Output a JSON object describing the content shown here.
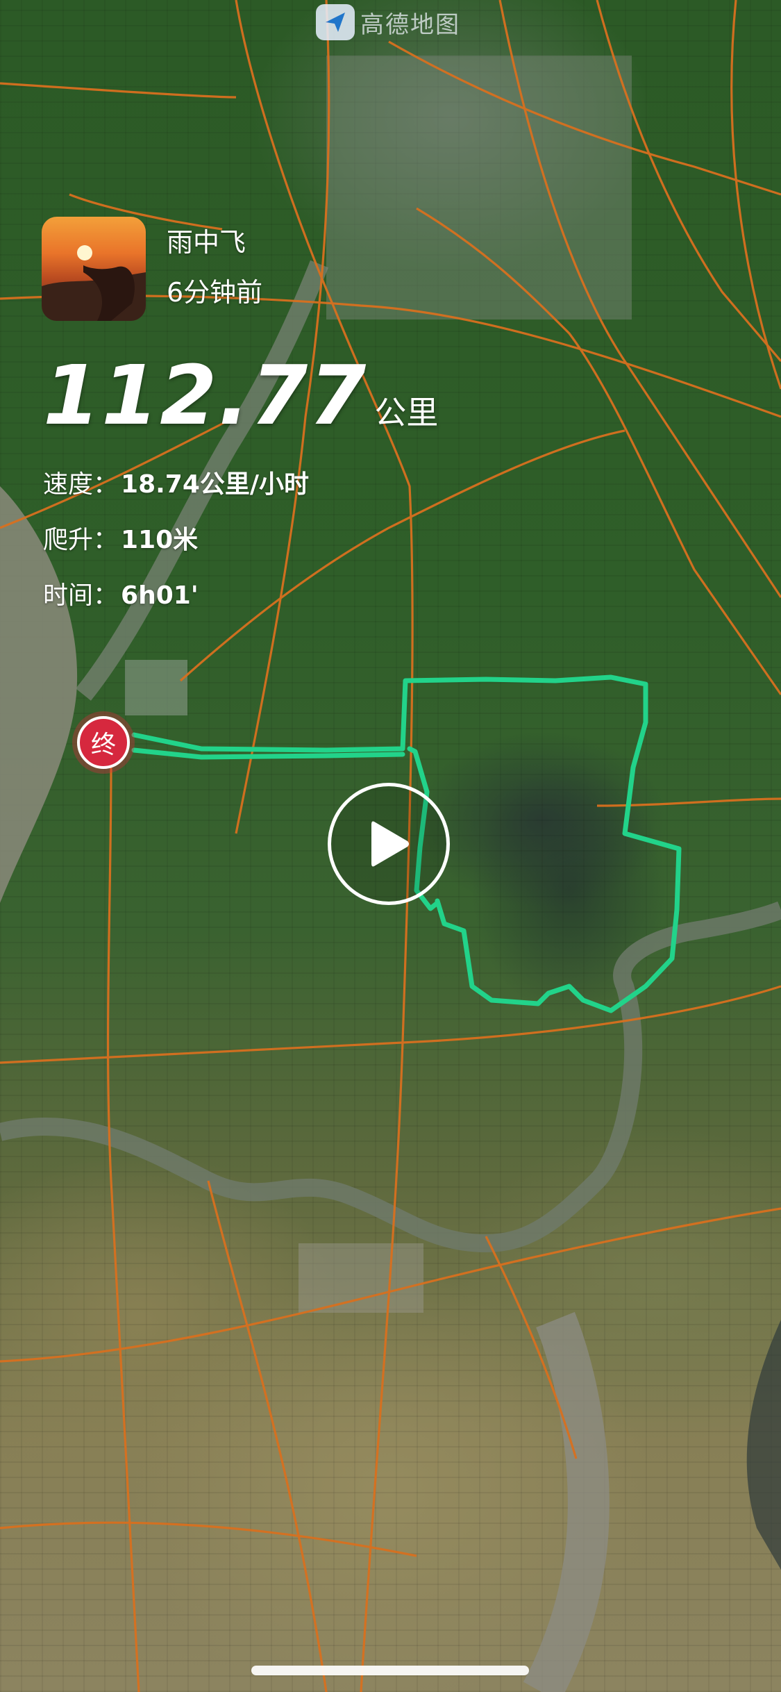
{
  "watermark": {
    "text": "高德地图",
    "icon": "amap-logo-icon"
  },
  "user": {
    "name": "雨中飞",
    "time_ago": "6分钟前",
    "avatar": "sunset-hand-avatar"
  },
  "activity": {
    "distance": "112.77",
    "distance_unit": "公里",
    "speed_label": "速度：",
    "speed_value": "18.74公里/小时",
    "climb_label": "爬升：",
    "climb_value": "110米",
    "time_label": "时间：",
    "time_value": "6h01'"
  },
  "map": {
    "end_marker_label": "终",
    "route_color": "#22d38a",
    "road_color": "#d8701f",
    "play_icon": "play-icon"
  }
}
